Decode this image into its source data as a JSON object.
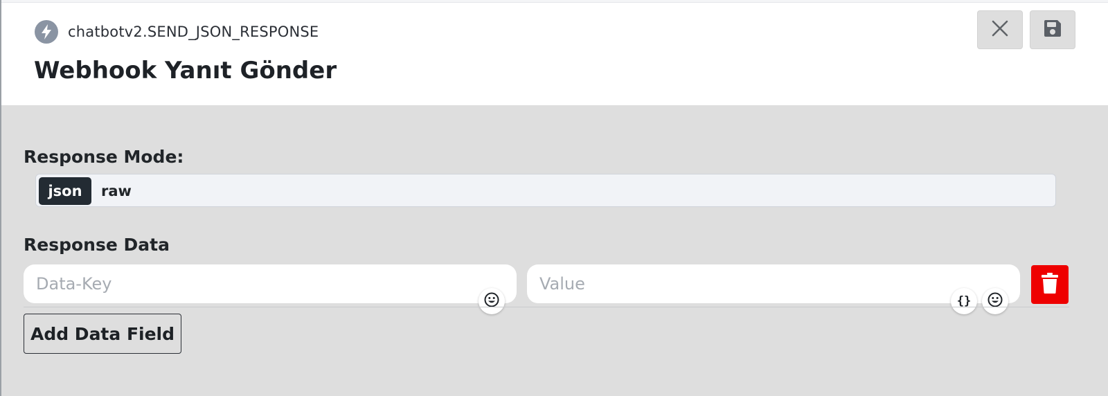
{
  "header": {
    "function_name": "chatbotv2.SEND_JSON_RESPONSE",
    "title": "Webhook Yanıt Gönder",
    "icons": {
      "function": "bolt-icon",
      "close": "close-icon",
      "save": "floppy-disk-icon"
    }
  },
  "response_mode": {
    "label": "Response Mode:",
    "options": [
      "json",
      "raw"
    ],
    "selected": "json"
  },
  "response_data": {
    "label": "Response Data",
    "rows": [
      {
        "key_placeholder": "Data-Key",
        "key_value": "",
        "value_placeholder": "Value",
        "value_value": ""
      }
    ],
    "icons": {
      "emoji": "smiley-icon",
      "json": "braces-icon",
      "delete": "trash-icon"
    },
    "braces_glyph": "{}",
    "add_button_label": "Add Data Field"
  },
  "colors": {
    "body_bg": "#dedede",
    "selected_mode_bg": "#232b33",
    "delete_bg": "#ee0000",
    "icon_gray": "#8a94a3"
  }
}
